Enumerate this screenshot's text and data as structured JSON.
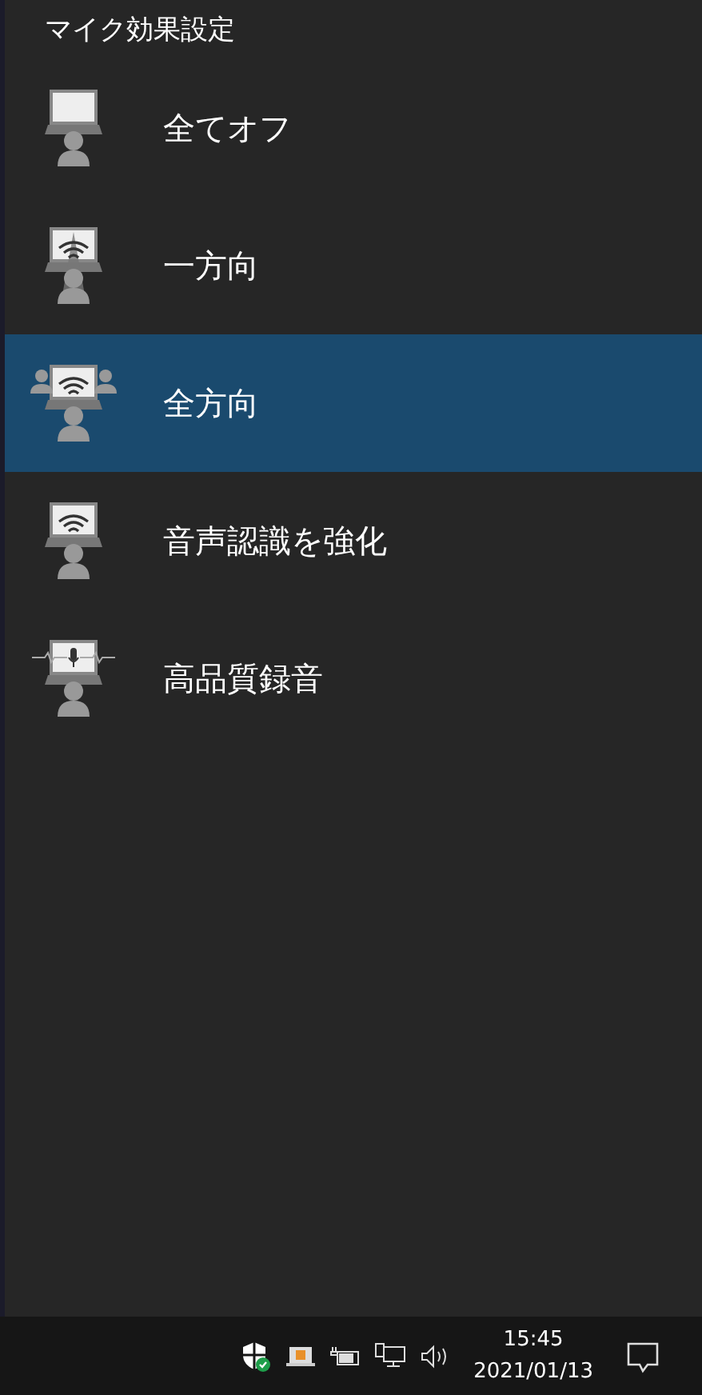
{
  "panel": {
    "title": "マイク効果設定"
  },
  "options": [
    {
      "kind": "off",
      "label": "全てオフ",
      "selected": false
    },
    {
      "kind": "directional",
      "label": "一方向",
      "selected": false
    },
    {
      "kind": "omni",
      "label": "全方向",
      "selected": true
    },
    {
      "kind": "speech",
      "label": "音声認識を強化",
      "selected": false
    },
    {
      "kind": "studio",
      "label": "高品質録音",
      "selected": false
    }
  ],
  "taskbar": {
    "time": "15:45",
    "date": "2021/01/13"
  }
}
